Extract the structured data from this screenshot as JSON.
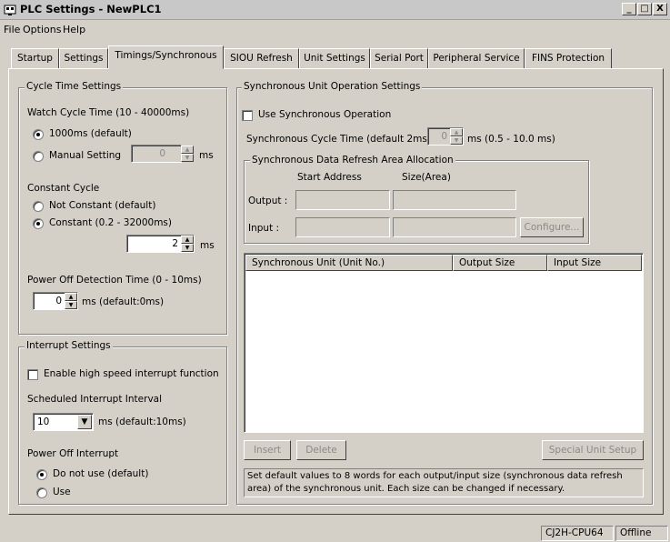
{
  "window": {
    "title": "PLC Settings - NewPLC1",
    "controls": {
      "minimize": "_",
      "maximize": "□",
      "close": "X"
    }
  },
  "menu": [
    "File",
    "Options",
    "Help"
  ],
  "tabs": [
    "Startup",
    "Settings",
    "Timings/Synchronous",
    "SIOU Refresh",
    "Unit Settings",
    "Serial Port",
    "Peripheral Service",
    "FINS Protection"
  ],
  "active_tab": "Timings/Synchronous",
  "cycle_time": {
    "group_title": "Cycle Time Settings",
    "watch_label": "Watch Cycle Time (10 - 40000ms)",
    "opt_default": "1000ms (default)",
    "opt_manual": "Manual Setting",
    "manual_value": "0",
    "manual_unit": "ms",
    "constant_label": "Constant Cycle",
    "opt_not_constant": "Not Constant (default)",
    "opt_constant": "Constant (0.2 - 32000ms)",
    "constant_value": "2",
    "constant_unit": "ms",
    "power_off_label": "Power Off Detection Time (0 - 10ms)",
    "power_off_value": "0",
    "power_off_unit": "ms (default:0ms)"
  },
  "interrupt": {
    "group_title": "Interrupt Settings",
    "enable_label": "Enable high speed interrupt function",
    "scheduled_label": "Scheduled Interrupt Interval",
    "scheduled_value": "10",
    "scheduled_unit": "ms (default:10ms)",
    "power_off_interrupt_label": "Power Off Interrupt",
    "opt_do_not_use": "Do not use (default)",
    "opt_use": "Use"
  },
  "sync": {
    "group_title": "Synchronous Unit Operation Settings",
    "use_label": "Use Synchronous Operation",
    "cycle_label": "Synchronous Cycle Time (default 2ms)",
    "cycle_value": "0",
    "cycle_unit": "ms (0.5 - 10.0 ms)",
    "refresh_title": "Synchronous Data Refresh Area Allocation",
    "col_start": "Start Address",
    "col_size": "Size(Area)",
    "output_label": "Output :",
    "input_label": "Input :",
    "configure_button": "Configure...",
    "list_columns": [
      "Synchronous Unit (Unit No.)",
      "Output Size",
      "Input Size"
    ],
    "insert_button": "Insert",
    "delete_button": "Delete",
    "special_button": "Special Unit Setup",
    "note": "Set default values to 8 words for each output/input size (synchronous data refresh area) of the synchronous unit. Each size can be changed if necessary."
  },
  "status": {
    "model": "CJ2H-CPU64",
    "mode": "Offline"
  }
}
